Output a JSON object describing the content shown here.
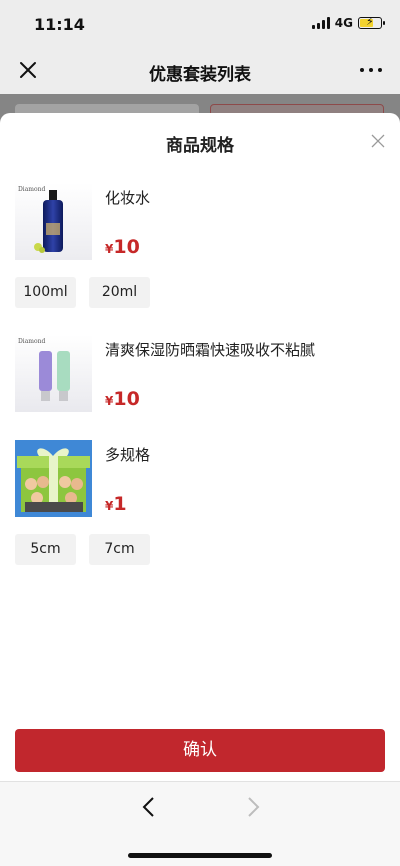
{
  "status_bar": {
    "time": "11:14",
    "network": "4G"
  },
  "nav": {
    "title": "优惠套装列表",
    "close_icon": "close-icon",
    "more_icon": "more-icon"
  },
  "sheet": {
    "title": "商品规格",
    "close_icon": "close-icon",
    "products": [
      {
        "name": "化妆水",
        "currency": "¥",
        "price": "10",
        "brand": "Diamond",
        "options": [
          "100ml",
          "20ml"
        ]
      },
      {
        "name": "清爽保湿防晒霜快速吸收不粘腻",
        "currency": "¥",
        "price": "10",
        "brand": "Diamond",
        "options": []
      },
      {
        "name": "多规格",
        "currency": "¥",
        "price": "1",
        "options": [
          "5cm",
          "7cm"
        ]
      }
    ],
    "confirm_label": "确认"
  },
  "bottom_nav": {
    "back_icon": "chevron-left-icon",
    "forward_icon": "chevron-right-icon"
  },
  "colors": {
    "accent": "#c1272d",
    "price": "#c62828"
  }
}
